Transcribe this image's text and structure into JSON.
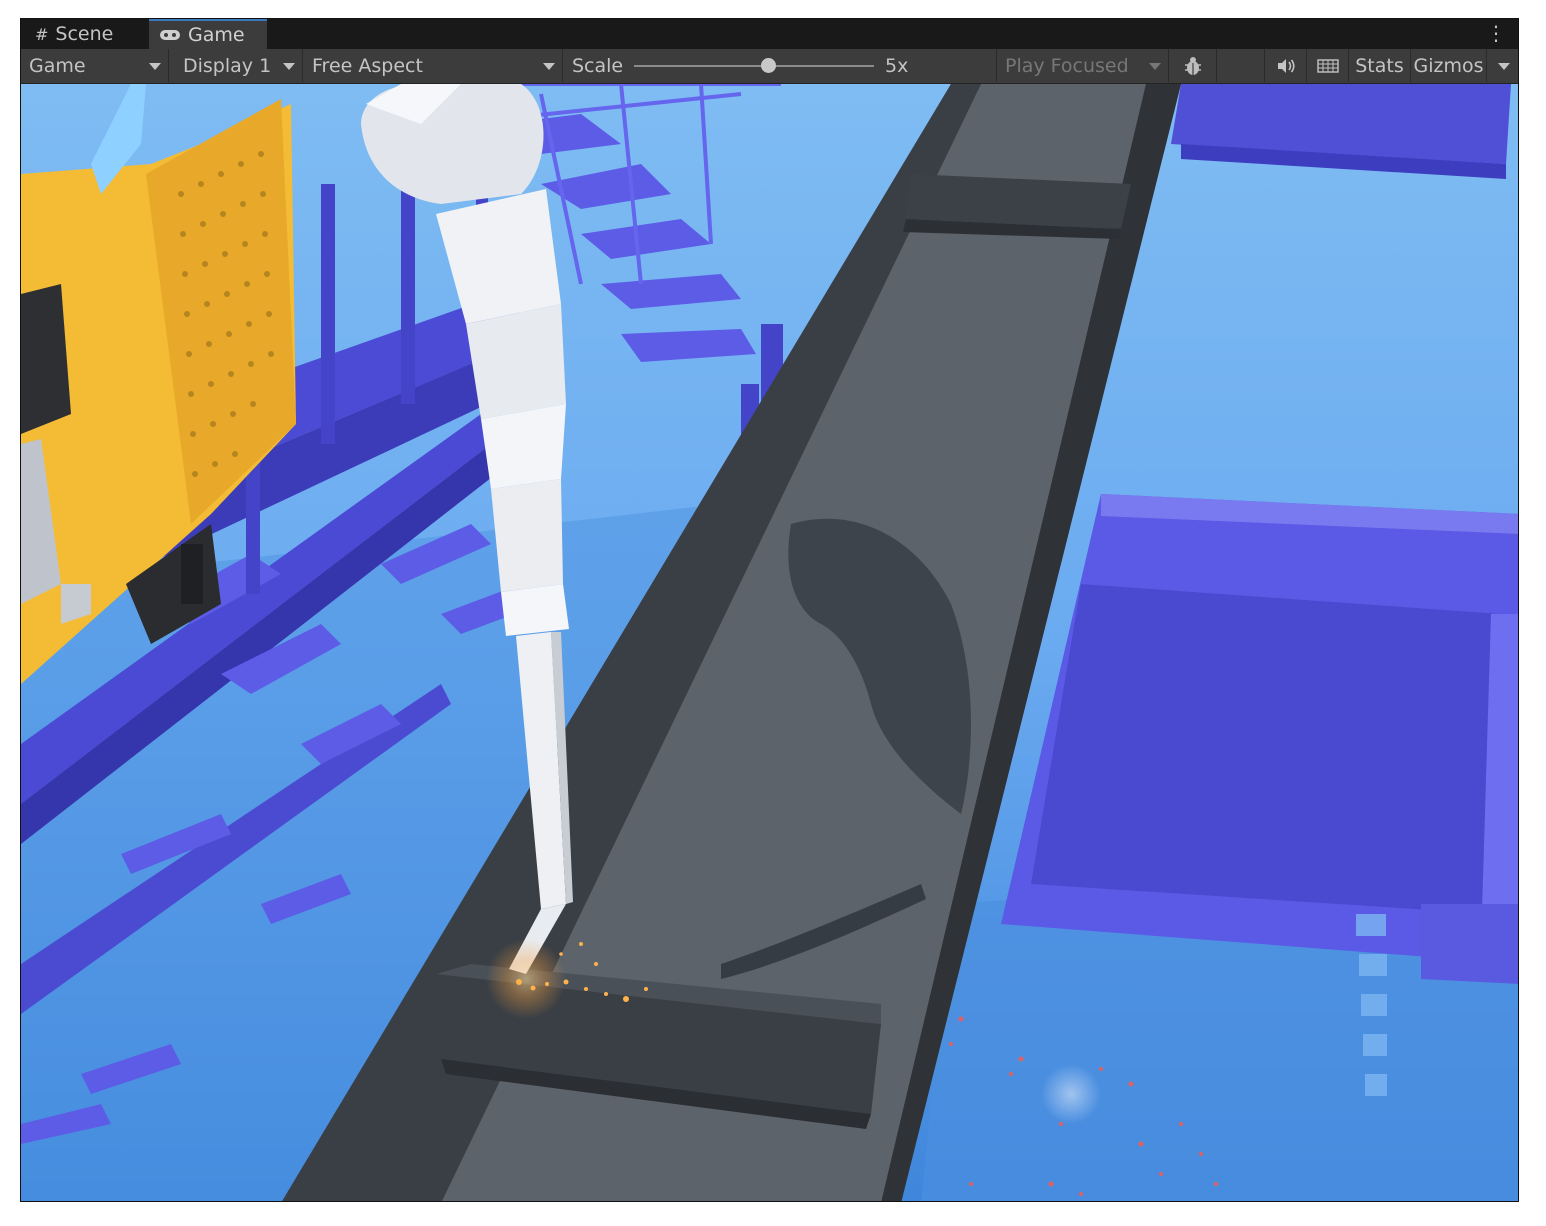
{
  "tabs": [
    {
      "label": "Scene",
      "icon": "grid-icon",
      "active": false
    },
    {
      "label": "Game",
      "icon": "gamepad-icon",
      "active": true
    }
  ],
  "toolbar": {
    "view_mode": "Game",
    "display": "Display 1",
    "aspect": "Free Aspect",
    "scale_label": "Scale",
    "scale_value": "5x",
    "play_mode": "Play Focused",
    "stats_label": "Stats",
    "gizmos_label": "Gizmos"
  },
  "colors": {
    "tab_accent": "#3a79bb",
    "toolbar_bg": "#3c3c3c",
    "sky": "#7fb8f0",
    "scaffold": "#5a5ae0",
    "robot_yellow": "#f2b830",
    "beam_gray": "#4a4f55"
  }
}
